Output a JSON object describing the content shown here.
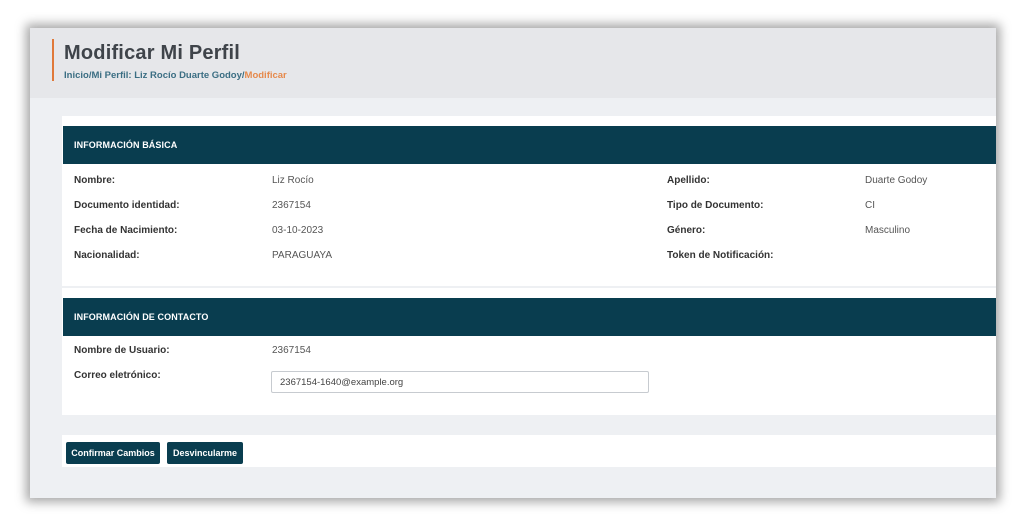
{
  "header": {
    "title": "Modificar Mi Perfil",
    "breadcrumb": {
      "home": "Inicio",
      "separator": "/",
      "profile": "Mi Perfil: Liz Rocío Duarte Godoy",
      "current": "Modificar"
    }
  },
  "basic_info": {
    "title": "INFORMACIÓN BÁSICA",
    "fields": {
      "nombre": {
        "label": "Nombre:",
        "value": "Liz Rocío"
      },
      "apellido": {
        "label": "Apellido:",
        "value": "Duarte Godoy"
      },
      "documento": {
        "label": "Documento identidad:",
        "value": "2367154"
      },
      "tipo_documento": {
        "label": "Tipo de Documento:",
        "value": "CI"
      },
      "fecha_nacimiento": {
        "label": "Fecha de Nacimiento:",
        "value": "03-10-2023"
      },
      "genero": {
        "label": "Género:",
        "value": "Masculino"
      },
      "nacionalidad": {
        "label": "Nacionalidad:",
        "value": "PARAGUAYA"
      },
      "token": {
        "label": "Token de Notificación:",
        "value": ""
      }
    }
  },
  "contact_info": {
    "title": "INFORMACIÓN DE CONTACTO",
    "usuario": {
      "label": "Nombre de Usuario:",
      "value": "2367154"
    },
    "correo": {
      "label": "Correo eletrónico:",
      "value": "2367154-1640@example.org"
    }
  },
  "actions": {
    "confirm_label": "Confirmar Cambios",
    "unlink_label": "Desvincularme"
  },
  "colors": {
    "header_bar": "#093d4f",
    "accent": "#e0793a",
    "breadcrumb_link": "#3b6e83",
    "breadcrumb_current": "#e6894b"
  }
}
